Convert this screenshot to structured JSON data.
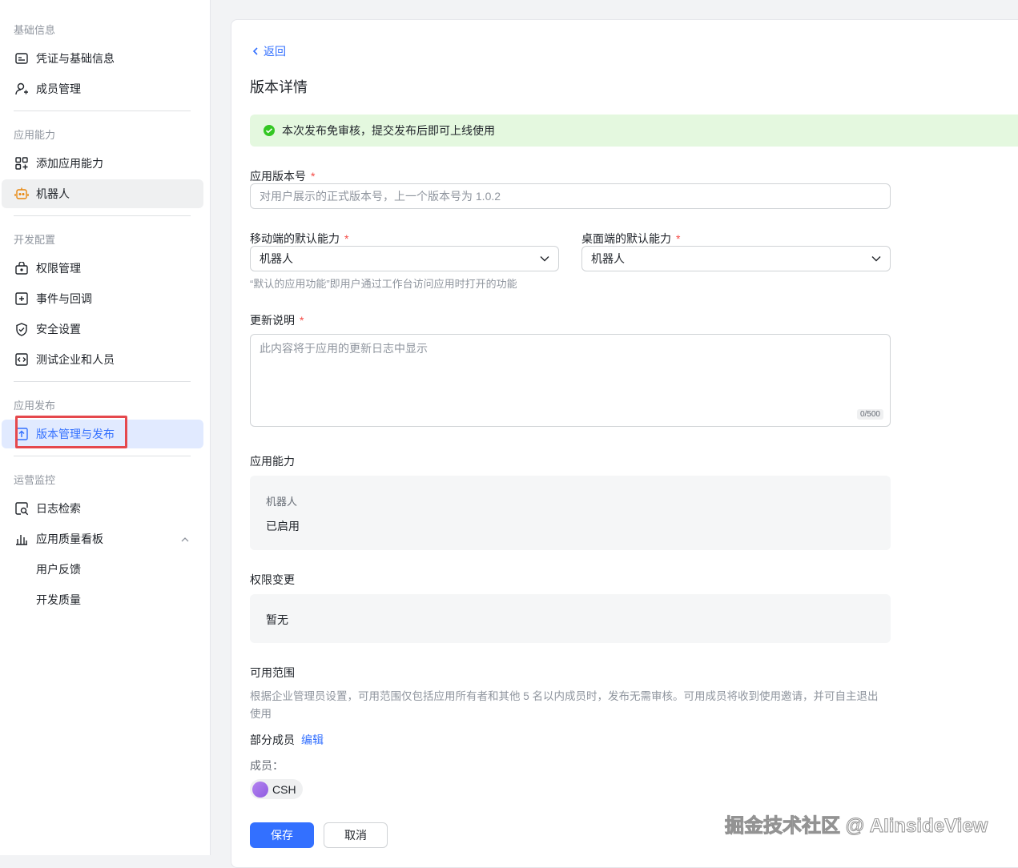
{
  "sidebar": {
    "groups": [
      "基础信息",
      "应用能力",
      "开发配置",
      "应用发布",
      "运营监控"
    ],
    "items": [
      "凭证与基础信息",
      "成员管理",
      "添加应用能力",
      "机器人",
      "权限管理",
      "事件与回调",
      "安全设置",
      "测试企业和人员",
      "版本管理与发布",
      "日志检索",
      "应用质量看板",
      "用户反馈",
      "开发质量"
    ]
  },
  "main": {
    "back": "返回",
    "title": "版本详情",
    "notice": "本次发布免审核，提交发布后即可上线使用",
    "version_label": "应用版本号",
    "version_placeholder": "对用户展示的正式版本号，上一个版本号为 1.0.2",
    "mobile_label": "移动端的默认能力",
    "mobile_value": "机器人",
    "desktop_label": "桌面端的默认能力",
    "desktop_value": "机器人",
    "default_hint": "“默认的应用功能”即用户通过工作台访问应用时打开的功能",
    "notes_label": "更新说明",
    "notes_placeholder": "此内容将于应用的更新日志中显示",
    "notes_count": "0/500",
    "ability_label": "应用能力",
    "ability_name": "机器人",
    "ability_status": "已启用",
    "perm_label": "权限变更",
    "perm_value": "暂无",
    "scope_label": "可用范围",
    "scope_desc": "根据企业管理员设置，可用范围仅包括应用所有者和其他 5 名以内成员时，发布无需审核。可用成员将收到使用邀请，并可自主退出使用",
    "scope_type": "部分成员",
    "edit": "编辑",
    "members_label": "成员：",
    "member": "CSH",
    "save": "保存",
    "cancel": "取消"
  },
  "watermark": "掘金技术社区 @ AIinsideView",
  "colors": {
    "primary": "#3370ff",
    "success": "#34c724",
    "notice_bg": "#e4f8df"
  }
}
